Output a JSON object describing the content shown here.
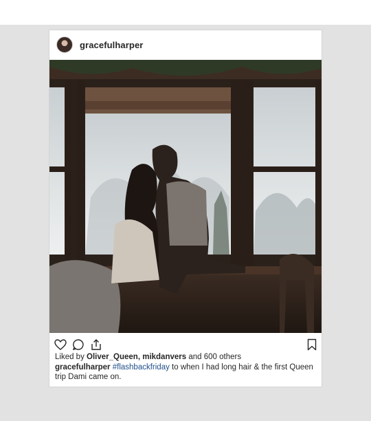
{
  "post": {
    "username": "gracefulharper",
    "photo_alt": "couple by window",
    "icons": {
      "like": "heart-icon",
      "comment": "comment-icon",
      "share": "share-icon",
      "save": "bookmark-icon"
    },
    "likes": {
      "prefix": "Liked by",
      "users": "Oliver_Queen, mikdanvers",
      "suffix": "and 600 others"
    },
    "caption": {
      "username": "gracefulharper",
      "hashtag": "#flashbackfriday",
      "text": "to when I had long hair & the first Queen trip Dami came on."
    }
  },
  "colors": {
    "background": "#e2e2e2",
    "card": "#ffffff",
    "text": "#262626",
    "hashtag": "#1f4f8b"
  }
}
